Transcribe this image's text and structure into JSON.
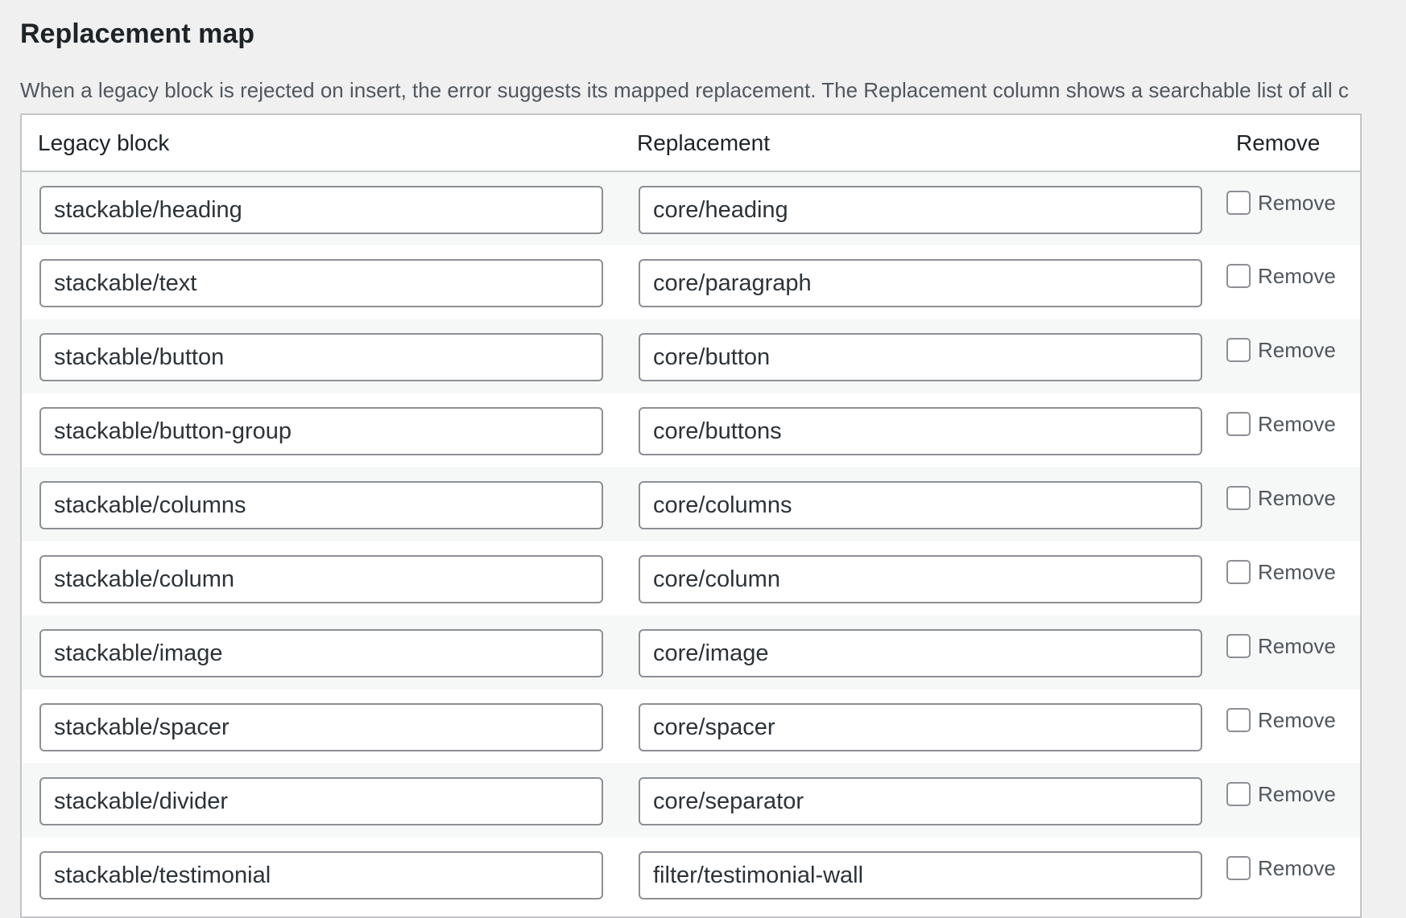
{
  "section": {
    "title": "Replacement map",
    "description": "When a legacy block is rejected on insert, the error suggests its mapped replacement. The Replacement column shows a searchable list of all c"
  },
  "table": {
    "headers": {
      "legacy": "Legacy block",
      "replacement": "Replacement",
      "remove": "Remove"
    },
    "rows": [
      {
        "legacy": "stackable/heading",
        "replacement": "core/heading",
        "remove_label": "Remove"
      },
      {
        "legacy": "stackable/text",
        "replacement": "core/paragraph",
        "remove_label": "Remove"
      },
      {
        "legacy": "stackable/button",
        "replacement": "core/button",
        "remove_label": "Remove"
      },
      {
        "legacy": "stackable/button-group",
        "replacement": "core/buttons",
        "remove_label": "Remove"
      },
      {
        "legacy": "stackable/columns",
        "replacement": "core/columns",
        "remove_label": "Remove"
      },
      {
        "legacy": "stackable/column",
        "replacement": "core/column",
        "remove_label": "Remove"
      },
      {
        "legacy": "stackable/image",
        "replacement": "core/image",
        "remove_label": "Remove"
      },
      {
        "legacy": "stackable/spacer",
        "replacement": "core/spacer",
        "remove_label": "Remove"
      },
      {
        "legacy": "stackable/divider",
        "replacement": "core/separator",
        "remove_label": "Remove"
      },
      {
        "legacy": "stackable/testimonial",
        "replacement": "filter/testimonial-wall",
        "remove_label": "Remove"
      }
    ]
  }
}
